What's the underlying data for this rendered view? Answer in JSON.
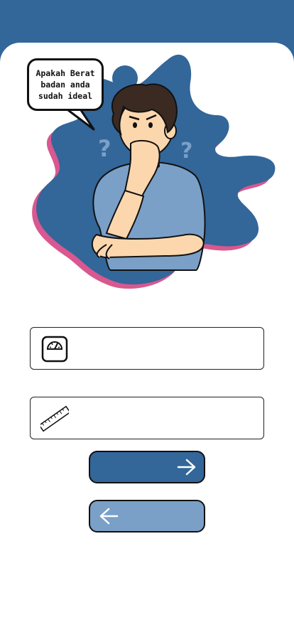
{
  "bubble": {
    "text": "Apakah Berat badan anda sudah ideal"
  },
  "weight_field": {
    "icon": "weighing-scale-icon",
    "value": "",
    "placeholder": ""
  },
  "height_field": {
    "icon": "ruler-icon",
    "value": "",
    "placeholder": ""
  },
  "buttons": {
    "next_icon": "arrow-right-icon",
    "back_icon": "arrow-left-icon"
  },
  "colors": {
    "primary": "#336699",
    "secondary": "#7aa0c8",
    "accent_pink": "#d9588f",
    "skin": "#fcd7ae",
    "hair": "#3b2a22"
  }
}
